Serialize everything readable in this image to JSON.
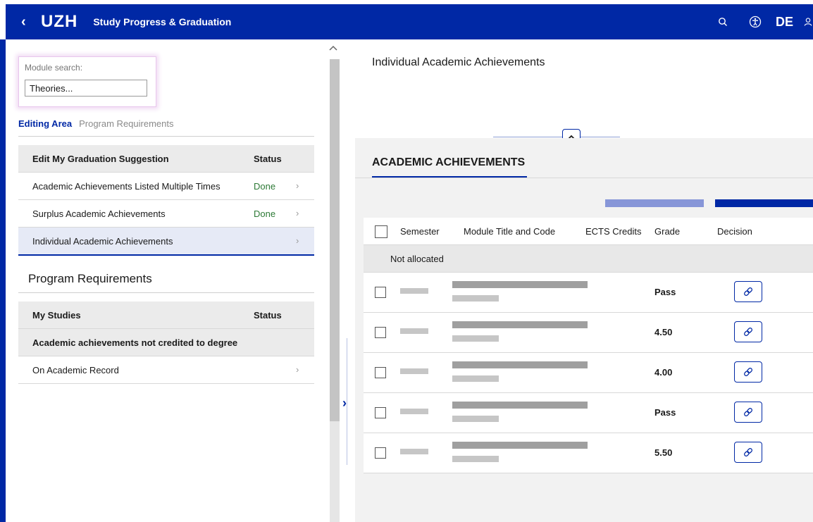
{
  "header": {
    "back_icon": "chevron-left-icon",
    "logo": "UZH",
    "title": "Study Progress & Graduation",
    "language": "DE",
    "icons": [
      "search-icon",
      "accessibility-icon",
      "user-icon"
    ],
    "brand_color": "#0028a5"
  },
  "search": {
    "label": "Module search:",
    "value": "Theories..."
  },
  "tabs": [
    {
      "label": "Editing Area",
      "active": true
    },
    {
      "label": "Program Requirements",
      "active": false
    }
  ],
  "graduation_table": {
    "header": {
      "name": "Edit My Graduation Suggestion",
      "status": "Status"
    },
    "rows": [
      {
        "name": "Academic Achievements Listed Multiple Times",
        "status": "Done"
      },
      {
        "name": "Surplus Academic Achievements",
        "status": "Done"
      },
      {
        "name": "Individual Academic Achievements",
        "status": "",
        "selected": true
      }
    ]
  },
  "program_requirements": {
    "title": "Program Requirements",
    "header": {
      "name": "My Studies",
      "status": "Status"
    },
    "section": "Academic achievements not credited to degree",
    "rows": [
      {
        "name": "On Academic Record"
      }
    ]
  },
  "right_panel": {
    "title": "Individual Academic Achievements",
    "subtitle": "ACADEMIC ACHIEVEMENTS",
    "columns": [
      "Semester",
      "Module Title and Code",
      "ECTS Credits",
      "Grade",
      "Decision"
    ],
    "group_label": "Not allocated",
    "rows": [
      {
        "grade": "Pass"
      },
      {
        "grade": "4.50"
      },
      {
        "grade": "4.00"
      },
      {
        "grade": "Pass"
      },
      {
        "grade": "5.50"
      }
    ]
  }
}
